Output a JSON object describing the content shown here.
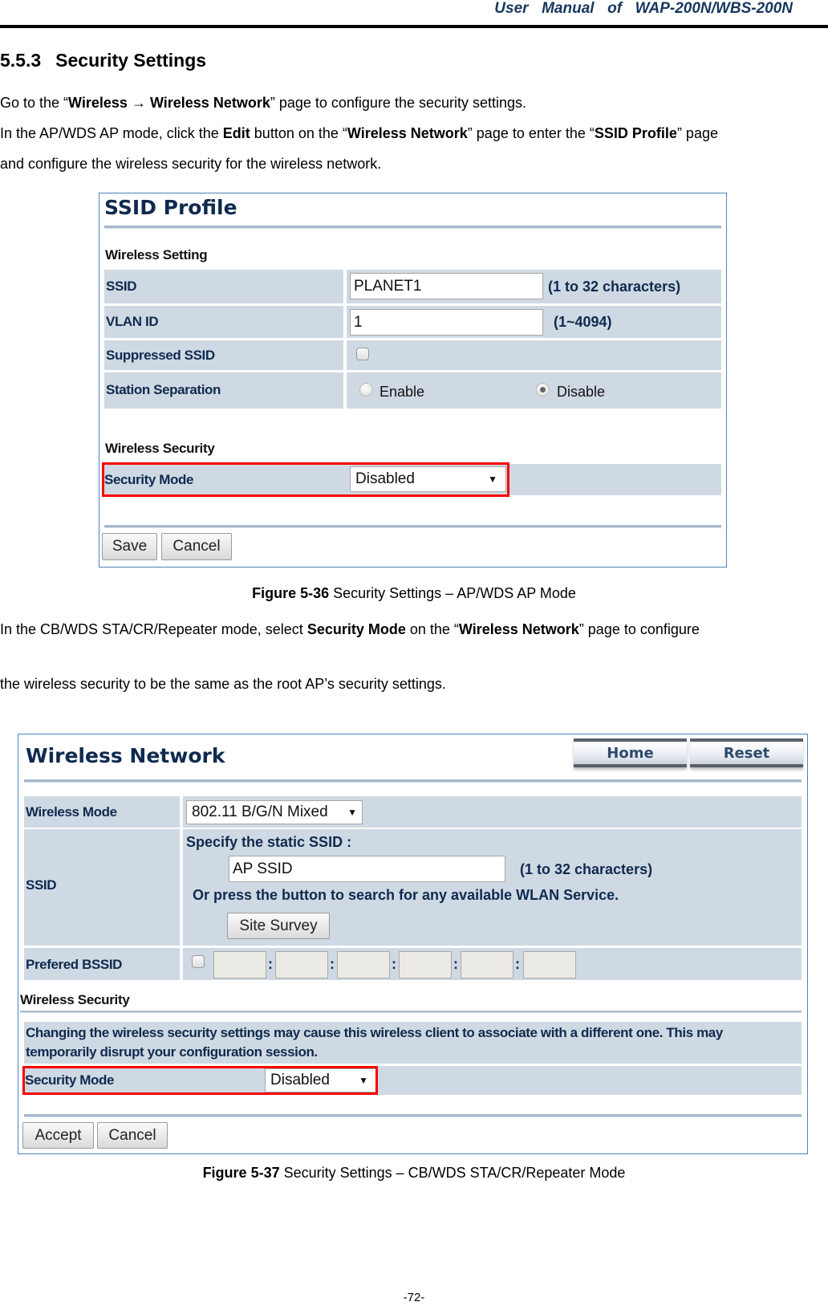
{
  "header": {
    "title": "User  Manual  of  WAP-200N/WBS-200N"
  },
  "section": {
    "number": "5.5.3",
    "title": "Security Settings"
  },
  "intro": {
    "line1": {
      "pre": "Go to the “",
      "b1": "Wireless ",
      "arrow": "→",
      "b2": " Wireless Network",
      "post": "” page to configure the security settings."
    },
    "line2": {
      "pre": "In the AP/WDS AP mode, click the ",
      "b1": "Edit",
      "mid1": " button on the “",
      "b2": "Wireless Network",
      "mid2": "” page to enter the “",
      "b3": "SSID Profile",
      "post": "” page"
    },
    "line3": "and configure the wireless security for the wireless network."
  },
  "figure1": {
    "title": "SSID Profile",
    "wireless_setting_heading": "Wireless Setting",
    "rows": {
      "ssid": {
        "label": "SSID",
        "value": "PLANET1",
        "hint": "(1 to 32 characters)"
      },
      "vlan": {
        "label": "VLAN ID",
        "value": "1",
        "hint": "(1~4094)"
      },
      "suppressed": {
        "label": "Suppressed SSID",
        "checked": false
      },
      "station": {
        "label": "Station Separation",
        "options": [
          "Enable",
          "Disable"
        ],
        "selected": "Disable"
      }
    },
    "wireless_security_heading": "Wireless Security",
    "security_mode": {
      "label": "Security Mode",
      "value": "Disabled"
    },
    "buttons": {
      "save": "Save",
      "cancel": "Cancel"
    },
    "caption": {
      "bold": "Figure 5-36",
      "text": " Security Settings – AP/WDS AP Mode"
    }
  },
  "middle": {
    "line1": {
      "pre": "In the CB/WDS STA/CR/Repeater mode, select ",
      "b1": "Security Mode",
      "mid": " on the “",
      "b2": "Wireless Network",
      "post": "” page to configure"
    },
    "line2": "the wireless security to be the same as the root AP’s security settings."
  },
  "figure2": {
    "title": "Wireless Network",
    "nav": {
      "home": "Home",
      "reset": "Reset"
    },
    "wireless_mode": {
      "label": "Wireless Mode",
      "value": "802.11 B/G/N Mixed"
    },
    "ssid": {
      "label": "SSID",
      "specify": "Specify the static SSID  :",
      "value": "AP SSID",
      "hint": "(1 to 32 characters)",
      "search_text": "Or press the button to search for any available WLAN Service.",
      "site_survey": "Site Survey"
    },
    "bssid": {
      "label": "Prefered BSSID",
      "checked": false,
      "separator": ":",
      "octets": [
        "",
        "",
        "",
        "",
        "",
        ""
      ]
    },
    "wireless_security_heading": "Wireless Security",
    "notice": "Changing the wireless security settings may cause this wireless client to associate with a different one. This may temporarily disrupt your configuration session.",
    "security_mode": {
      "label": "Security Mode",
      "value": "Disabled"
    },
    "buttons": {
      "accept": "Accept",
      "cancel": "Cancel"
    },
    "caption": {
      "bold": "Figure 5-37",
      "text": " Security Settings – CB/WDS STA/CR/Repeater Mode"
    }
  },
  "footer": {
    "page": "-72-"
  },
  "colors": {
    "highlight": "#ff0000",
    "row_bg": "#cfd9e3",
    "label_text": "#0f2a4f",
    "header_text": "#17375e"
  }
}
